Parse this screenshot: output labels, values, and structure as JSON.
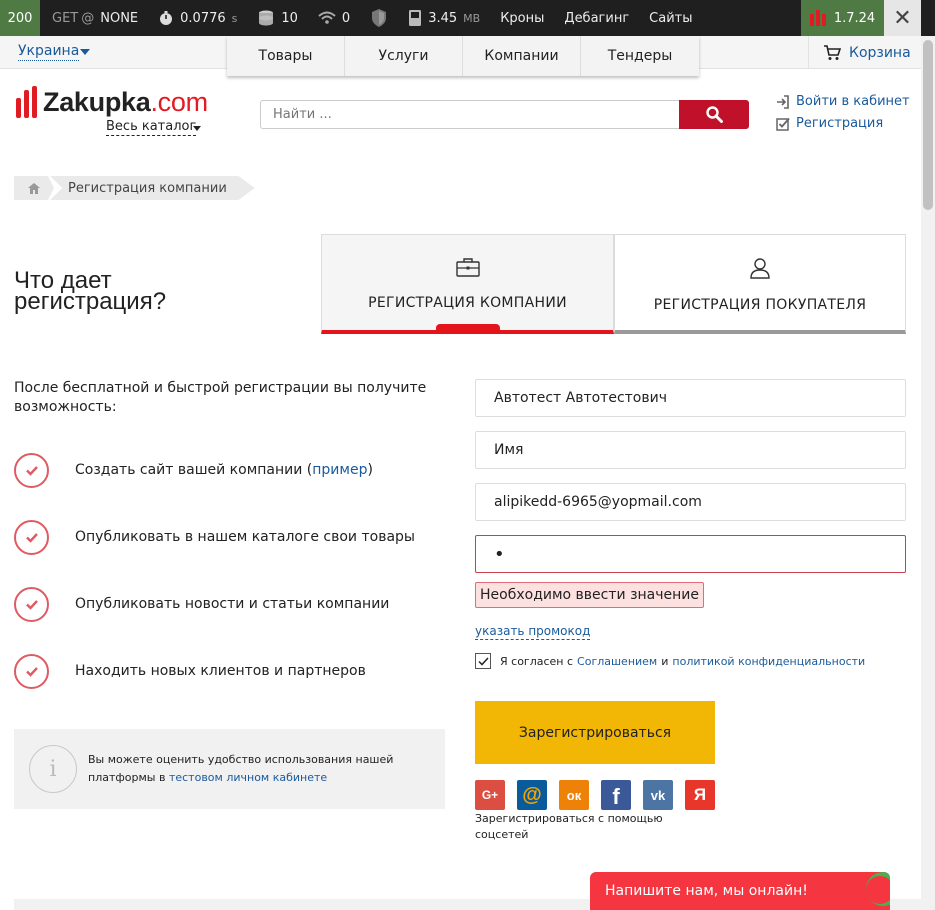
{
  "debug": {
    "status": "200",
    "method": "GET",
    "route": "NONE",
    "time": "0.0776",
    "time_unit": "s",
    "queries": "10",
    "count2": "0",
    "memory": "3.45",
    "memory_unit": "MB",
    "links": [
      "Кроны",
      "Дебагинг",
      "Сайты"
    ],
    "version": "1.7.24"
  },
  "topnav": {
    "region": "Украина",
    "tabs": [
      "Товары",
      "Услуги",
      "Компании",
      "Тендеры"
    ],
    "cart": "Корзина"
  },
  "header": {
    "logo_main": "Zakupka",
    "logo_tld": ".com",
    "catalog": "Весь каталог",
    "search_placeholder": "Найти ...",
    "login": "Войти в кабинет",
    "register": "Регистрация"
  },
  "breadcrumb": {
    "current": "Регистрация компании"
  },
  "page": {
    "heading": "Что дает регистрация?",
    "tab_company": "РЕГИСТРАЦИЯ КОМПАНИИ",
    "tab_buyer": "РЕГИСТРАЦИЯ ПОКУПАТЕЛЯ",
    "intro": "После бесплатной и быстрой регистрации вы получите возможность:",
    "benefits": {
      "b1_text": "Создать сайт вашей компании (",
      "b1_link": "пример",
      "b1_end": ")",
      "b2": "Опубликовать в нашем каталоге свои товары",
      "b3": "Опубликовать новости и статьи компании",
      "b4": "Находить новых клиентов и партнеров"
    },
    "info_text": "Вы можете оценить удобство использования нашей платформы в ",
    "info_link": "тестовом личном кабинете"
  },
  "form": {
    "company_value": "Автотест Автотестович",
    "name_value": "Имя",
    "email_value": "alipikedd-6965@yopmail.com",
    "password_value": "•",
    "error": "Необходимо ввести значение",
    "promo": "указать промокод",
    "agree_prefix": "Я согласен с ",
    "agree_link1": "Соглашением",
    "agree_mid": " и ",
    "agree_link2": "политикой конфиденциальности",
    "submit": "Зарегистрироваться",
    "social_caption": "Зарегистрироваться с помощью соцсетей",
    "socials": [
      {
        "name": "google-plus",
        "glyph": "G+",
        "color": "#dc4e41"
      },
      {
        "name": "mail-ru",
        "glyph": "@",
        "color": "#0a5b9c"
      },
      {
        "name": "odnoklassniki",
        "glyph": "ок",
        "color": "#ee8208"
      },
      {
        "name": "facebook",
        "glyph": "f",
        "color": "#3b5998"
      },
      {
        "name": "vkontakte",
        "glyph": "vk",
        "color": "#4c75a3"
      },
      {
        "name": "yandex",
        "glyph": "Я",
        "color": "#e8362b"
      }
    ]
  },
  "chat": {
    "text": "Напишите нам, мы онлайн!"
  },
  "colors": {
    "brand_red": "#e11b22",
    "accent_yellow": "#f2b705",
    "link_blue": "#1a5a9c"
  }
}
